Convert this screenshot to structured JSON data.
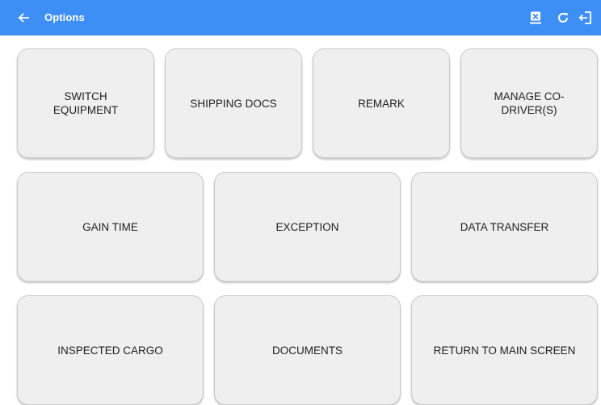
{
  "header": {
    "title": "Options",
    "back_icon": "arrow-left-icon",
    "actions": [
      {
        "icon": "export-box-icon"
      },
      {
        "icon": "refresh-icon"
      },
      {
        "icon": "logout-icon"
      }
    ],
    "bar_color": "#3d8ef5"
  },
  "tiles": {
    "switch_equipment": "SWITCH EQUIPMENT",
    "shipping_docs": "SHIPPING DOCS",
    "remark": "REMARK",
    "manage_co_drivers": "MANAGE CO-DRIVER(S)",
    "gain_time": "GAIN TIME",
    "exception": "EXCEPTION",
    "data_transfer": "DATA TRANSFER",
    "inspected_cargo": "INSPECTED CARGO",
    "documents": "DOCUMENTS",
    "return_to_main": "RETURN TO MAIN SCREEN"
  }
}
